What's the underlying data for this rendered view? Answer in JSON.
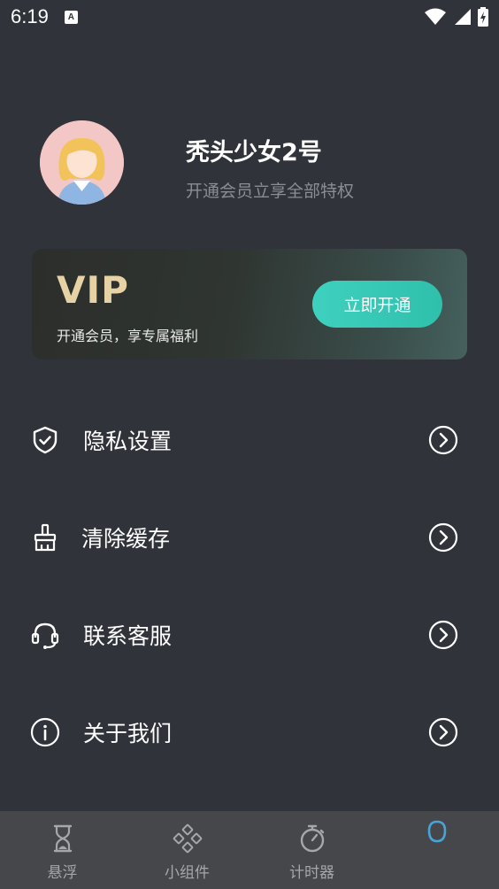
{
  "status_bar": {
    "time": "6:19",
    "notification_icon": "A"
  },
  "profile": {
    "name": "秃头少女2号",
    "subtitle": "开通会员立享全部特权",
    "avatar_icon": "girl-avatar-icon"
  },
  "vip_card": {
    "title": "VIP",
    "subtitle": "开通会员，享专属福利",
    "button_label": "立即开通"
  },
  "menu": {
    "items": [
      {
        "label": "隐私设置",
        "icon": "shield-check-icon"
      },
      {
        "label": "清除缓存",
        "icon": "broom-icon"
      },
      {
        "label": "联系客服",
        "icon": "headset-icon"
      },
      {
        "label": "关于我们",
        "icon": "info-icon"
      }
    ]
  },
  "bottom_nav": {
    "items": [
      {
        "label": "悬浮",
        "icon": "hourglass-icon"
      },
      {
        "label": "小组件",
        "icon": "widgets-icon"
      },
      {
        "label": "计时器",
        "icon": "stopwatch-icon"
      },
      {
        "label": "",
        "icon": "profile-icon"
      }
    ]
  },
  "colors": {
    "background": "#30333a",
    "accent": "#3fd1bf",
    "vip_gold": "#e6d2a4",
    "nav_bg": "#45474b",
    "active_icon": "#4aa3d6"
  }
}
